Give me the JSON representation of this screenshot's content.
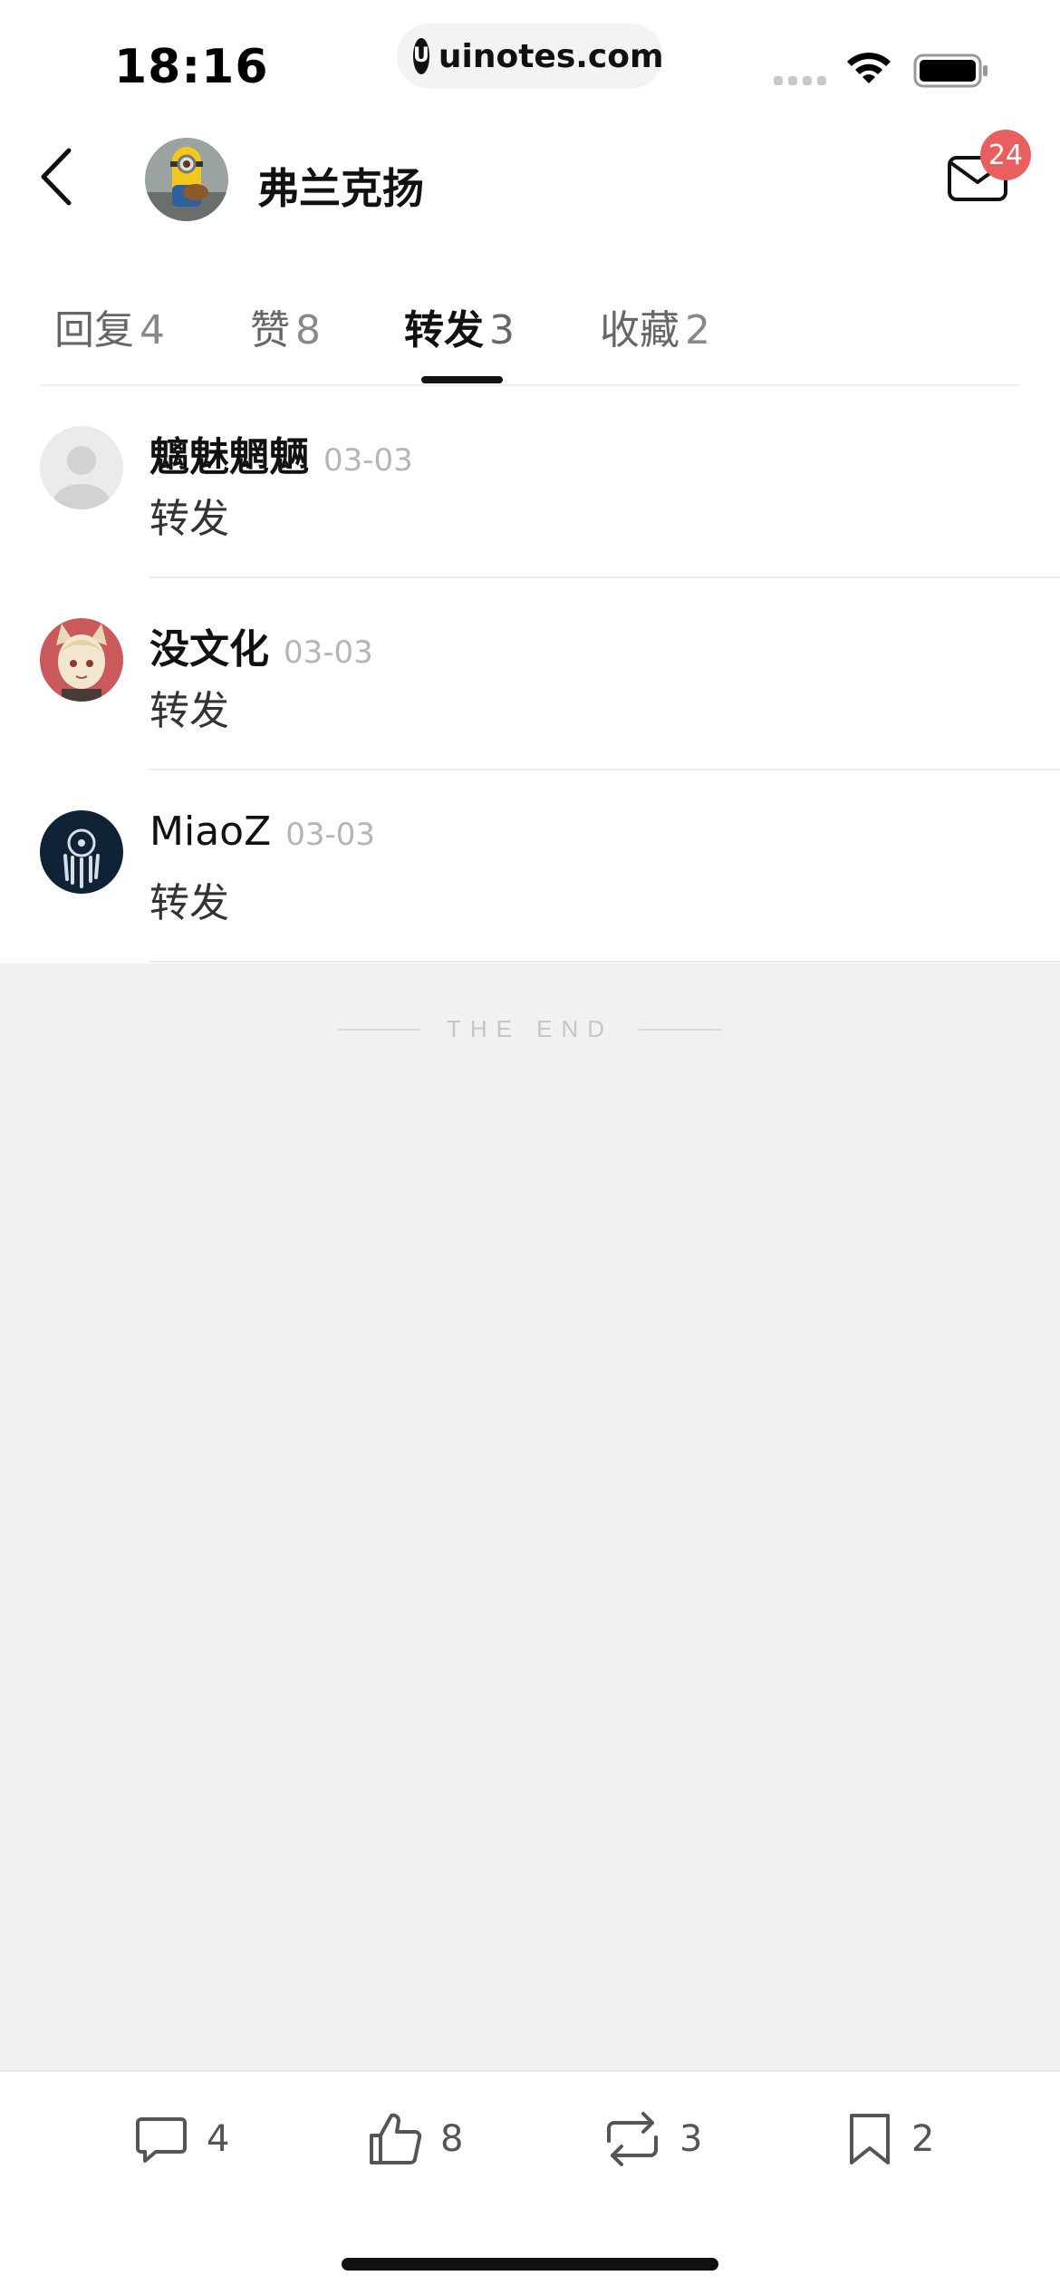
{
  "status_bar": {
    "time": "18:16",
    "url": "uinotes.com",
    "url_logo": "U"
  },
  "header": {
    "title": "弗兰克扬",
    "mail_badge": "24"
  },
  "tabs": [
    {
      "label": "回复",
      "count": "4",
      "active": false
    },
    {
      "label": "赞",
      "count": "8",
      "active": false
    },
    {
      "label": "转发",
      "count": "3",
      "active": true
    },
    {
      "label": "收藏",
      "count": "2",
      "active": false
    }
  ],
  "list": [
    {
      "name": "魑魅魍魉",
      "date": "03-03",
      "text": "转发"
    },
    {
      "name": "没文化",
      "date": "03-03",
      "text": "转发"
    },
    {
      "name": "MiaoZ",
      "date": "03-03",
      "text": "转发"
    }
  ],
  "end_text": "THE END",
  "bottom_bar": {
    "comments": "4",
    "likes": "8",
    "reposts": "3",
    "bookmarks": "2"
  },
  "colors": {
    "badge": "#e95f5f",
    "background": "#f1f1f1",
    "active_tab": "#111111"
  },
  "icons": [
    "back-chevron-icon",
    "mail-icon",
    "comment-icon",
    "thumbs-up-icon",
    "repost-icon",
    "bookmark-icon",
    "wifi-icon",
    "battery-icon"
  ]
}
